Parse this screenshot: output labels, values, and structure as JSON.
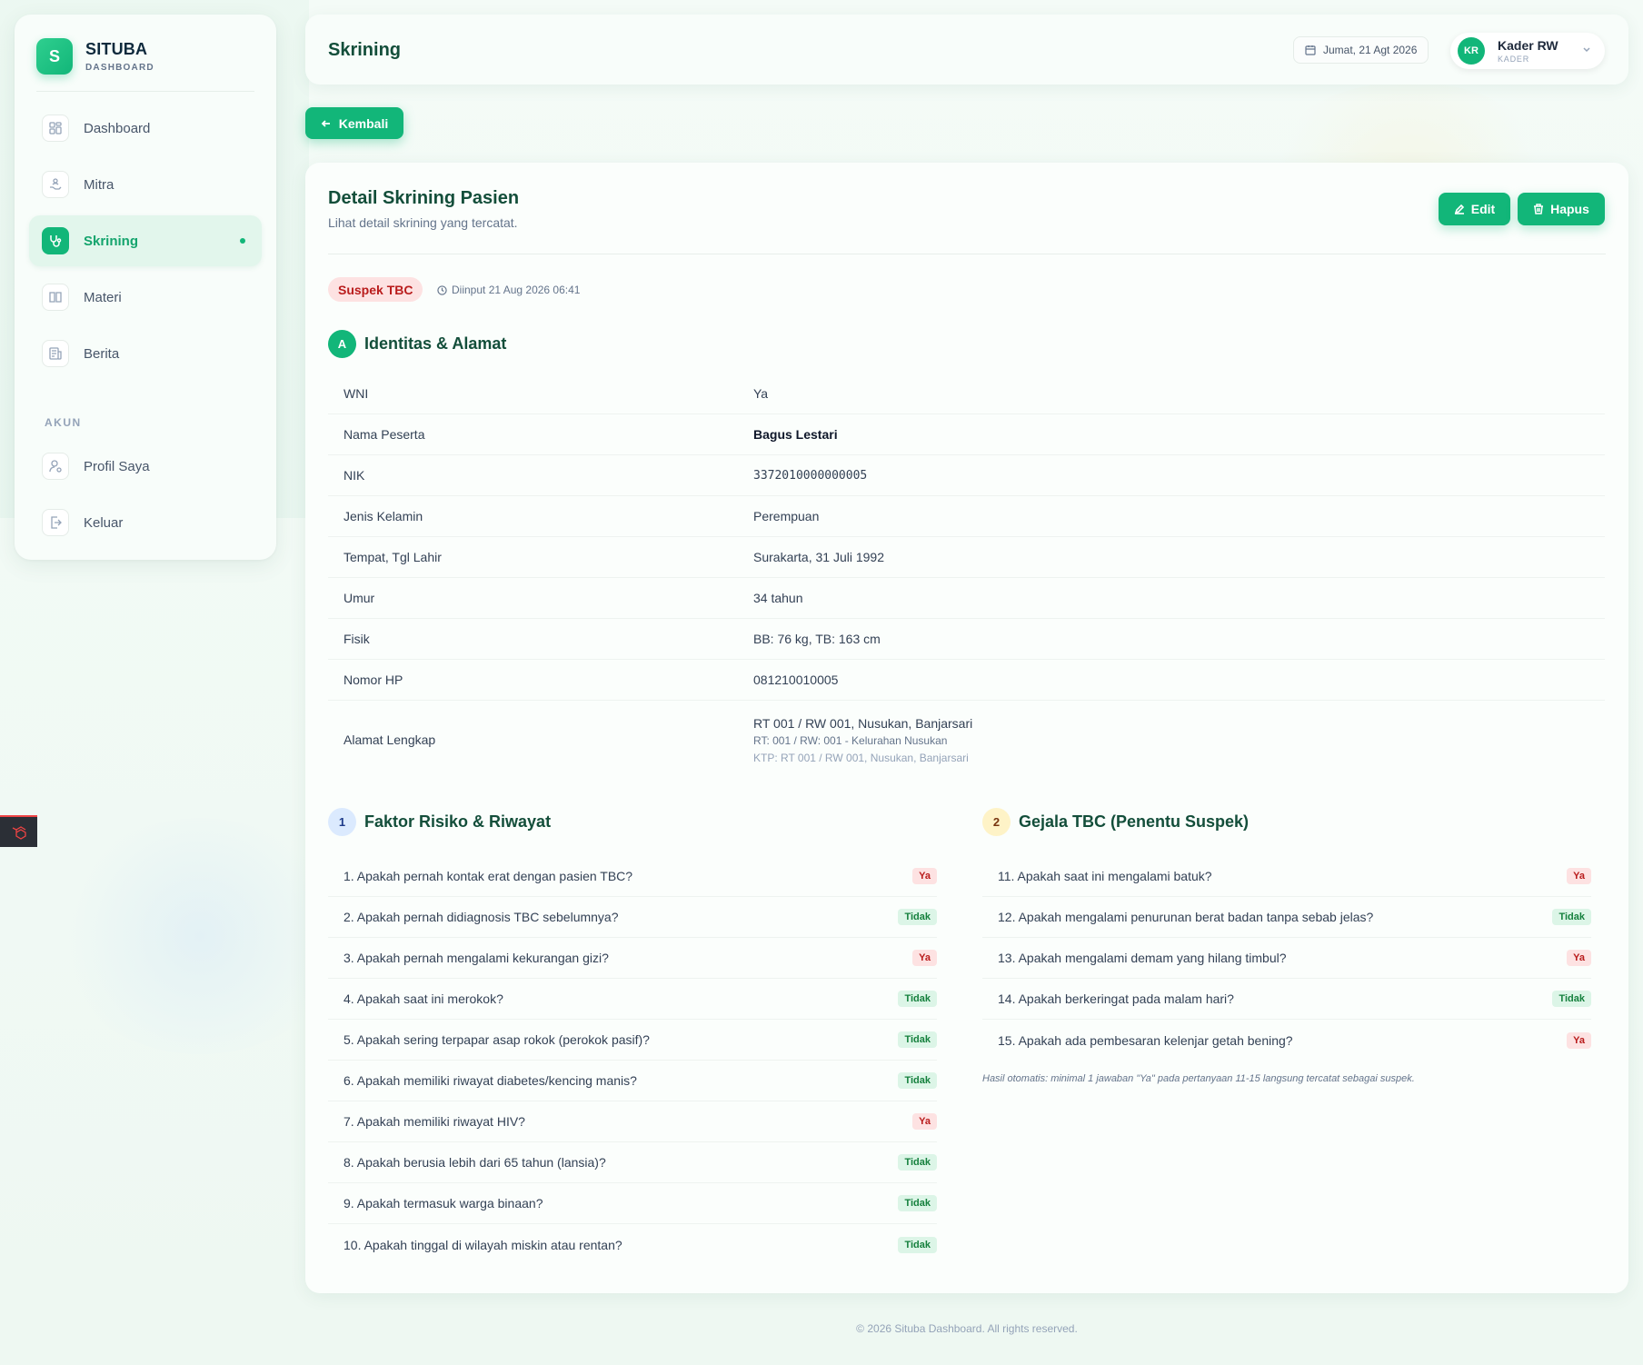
{
  "brand": {
    "name": "SITUBA",
    "subtitle": "DASHBOARD"
  },
  "sidebar": {
    "items": [
      {
        "label": "Dashboard",
        "icon": "grid-icon",
        "active": false
      },
      {
        "label": "Mitra",
        "icon": "handshake-icon",
        "active": false
      },
      {
        "label": "Skrining",
        "icon": "stethoscope-icon",
        "active": true
      },
      {
        "label": "Materi",
        "icon": "book-icon",
        "active": false
      },
      {
        "label": "Berita",
        "icon": "newspaper-icon",
        "active": false
      }
    ],
    "section_label": "AKUN",
    "account_items": [
      {
        "label": "Profil Saya",
        "icon": "user-icon"
      },
      {
        "label": "Keluar",
        "icon": "logout-icon"
      }
    ]
  },
  "header": {
    "title": "Skrining",
    "date": "Jumat, 21 Agt 2026",
    "user": {
      "initials": "KR",
      "name": "Kader RW",
      "role": "KADER"
    }
  },
  "back_label": "Kembali",
  "card": {
    "title": "Detail Skrining Pasien",
    "subtitle": "Lihat detail skrining yang tercatat.",
    "edit_label": "Edit",
    "delete_label": "Hapus",
    "status": "Suspek TBC",
    "input_time": "Diinput 21 Aug 2026 06:41"
  },
  "identity": {
    "badge": "A",
    "title": "Identitas & Alamat",
    "rows": [
      {
        "label": "WNI",
        "value": "Ya"
      },
      {
        "label": "Nama Peserta",
        "value": "Bagus Lestari"
      },
      {
        "label": "NIK",
        "value": "3372010000000005"
      },
      {
        "label": "Jenis Kelamin",
        "value": "Perempuan"
      },
      {
        "label": "Tempat, Tgl Lahir",
        "value": "Surakarta, 31 Juli 1992"
      },
      {
        "label": "Umur",
        "value": "34 tahun"
      },
      {
        "label": "Fisik",
        "value": "BB: 76 kg, TB: 163 cm"
      },
      {
        "label": "Nomor HP",
        "value": "081210010005"
      }
    ],
    "address": {
      "label": "Alamat Lengkap",
      "main": "RT 001 / RW 001, Nusukan, Banjarsari",
      "detail": "RT: 001 / RW: 001 - Kelurahan Nusukan",
      "ktp": "KTP: RT 001 / RW 001, Nusukan, Banjarsari"
    }
  },
  "risk": {
    "badge": "1",
    "title": "Faktor Risiko & Riwayat",
    "questions": [
      {
        "q": "1. Apakah pernah kontak erat dengan pasien TBC?",
        "a": "Ya"
      },
      {
        "q": "2. Apakah pernah didiagnosis TBC sebelumnya?",
        "a": "Tidak"
      },
      {
        "q": "3. Apakah pernah mengalami kekurangan gizi?",
        "a": "Ya"
      },
      {
        "q": "4. Apakah saat ini merokok?",
        "a": "Tidak"
      },
      {
        "q": "5. Apakah sering terpapar asap rokok (perokok pasif)?",
        "a": "Tidak"
      },
      {
        "q": "6. Apakah memiliki riwayat diabetes/kencing manis?",
        "a": "Tidak"
      },
      {
        "q": "7. Apakah memiliki riwayat HIV?",
        "a": "Ya"
      },
      {
        "q": "8. Apakah berusia lebih dari 65 tahun (lansia)?",
        "a": "Tidak"
      },
      {
        "q": "9. Apakah termasuk warga binaan?",
        "a": "Tidak"
      },
      {
        "q": "10. Apakah tinggal di wilayah miskin atau rentan?",
        "a": "Tidak"
      }
    ]
  },
  "symptoms": {
    "badge": "2",
    "title": "Gejala TBC (Penentu Suspek)",
    "questions": [
      {
        "q": "11. Apakah saat ini mengalami batuk?",
        "a": "Ya"
      },
      {
        "q": "12. Apakah mengalami penurunan berat badan tanpa sebab jelas?",
        "a": "Tidak"
      },
      {
        "q": "13. Apakah mengalami demam yang hilang timbul?",
        "a": "Ya"
      },
      {
        "q": "14. Apakah berkeringat pada malam hari?",
        "a": "Tidak"
      },
      {
        "q": "15. Apakah ada pembesaran kelenjar getah bening?",
        "a": "Ya"
      }
    ],
    "note": "Hasil otomatis: minimal 1 jawaban \"Ya\" pada pertanyaan 11-15 langsung tercatat sebagai suspek."
  },
  "footer": "© 2026 Situba Dashboard. All rights reserved.",
  "colors": {
    "accent": "#12b679",
    "danger": "#b91c1c",
    "title": "#134e3a"
  }
}
